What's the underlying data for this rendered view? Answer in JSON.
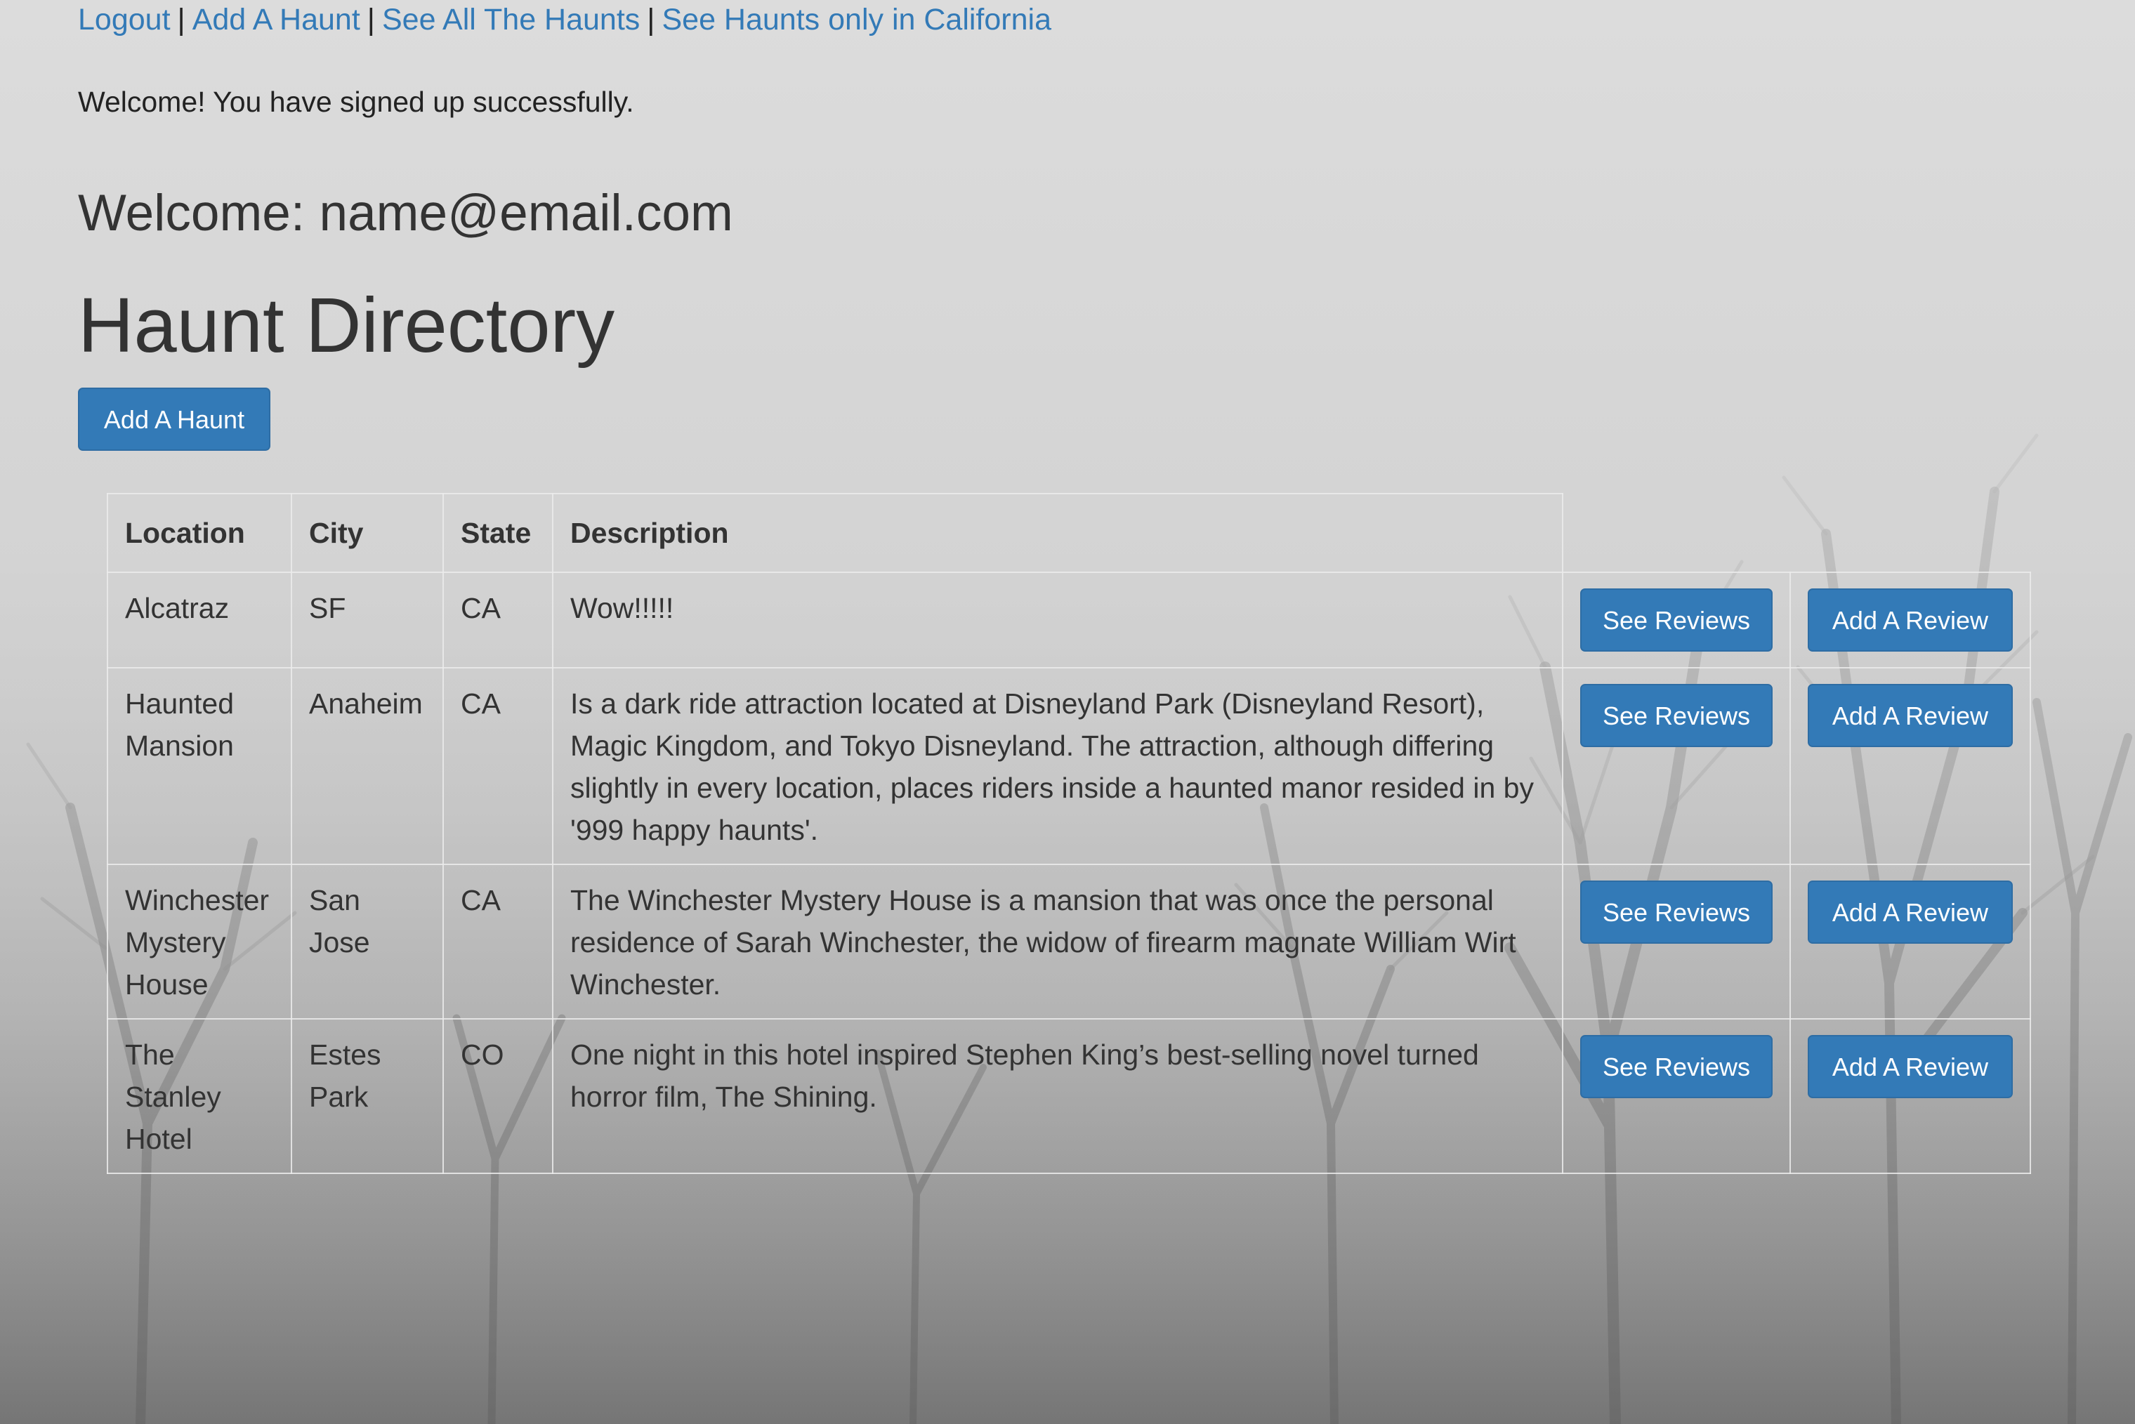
{
  "nav": {
    "links": [
      "Logout",
      "Add A Haunt",
      "See All The Haunts",
      "See Haunts only in California"
    ],
    "separator": "|"
  },
  "flash_message": "Welcome! You have signed up successfully.",
  "welcome_text": "Welcome: name@email.com",
  "page_title": "Haunt Directory",
  "add_haunt_button": "Add A Haunt",
  "table": {
    "headers": [
      "Location",
      "City",
      "State",
      "Description"
    ],
    "rows": [
      {
        "location": "Alcatraz",
        "city": "SF",
        "state": "CA",
        "description": "Wow!!!!!",
        "see_reviews": "See Reviews",
        "add_review": "Add A Review"
      },
      {
        "location": "Haunted Mansion",
        "city": "Anaheim",
        "state": "CA",
        "description": "Is a dark ride attraction located at Disneyland Park (Disneyland Resort), Magic Kingdom, and Tokyo Disneyland. The attraction, although differing slightly in every location, places riders inside a haunted manor resided in by '999 happy haunts'.",
        "see_reviews": "See Reviews",
        "add_review": "Add A Review"
      },
      {
        "location": "Winchester Mystery House",
        "city": "San Jose",
        "state": "CA",
        "description": "The Winchester Mystery House is a mansion that was once the personal residence of Sarah Winchester, the widow of firearm magnate William Wirt Winchester.",
        "see_reviews": "See Reviews",
        "add_review": "Add A Review"
      },
      {
        "location": "The Stanley Hotel",
        "city": "Estes Park",
        "state": "CO",
        "description": "One night in this hotel inspired Stephen King’s best-selling novel turned horror film, The Shining.",
        "see_reviews": "See Reviews",
        "add_review": "Add A Review"
      }
    ]
  },
  "colors": {
    "link": "#337ab7",
    "button_bg": "#337ab7",
    "button_border": "#2e6da4",
    "text": "#333333"
  },
  "background": "foggy-trees-image"
}
